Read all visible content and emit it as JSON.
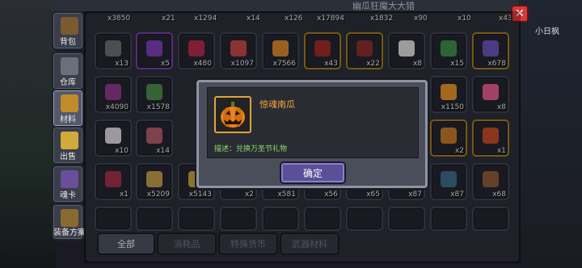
{
  "background": {
    "header_title": "幽瓜狂魔大大猎"
  },
  "sidebar": {
    "items": [
      {
        "label": "背包"
      },
      {
        "label": "仓库"
      },
      {
        "label": "材料"
      },
      {
        "label": "出售"
      },
      {
        "label": "魂卡"
      },
      {
        "label": "装备方案"
      }
    ],
    "active_index": 2
  },
  "close_label": "✕",
  "right_label": "小日枫",
  "top_row_counts": [
    "x3850",
    "x21",
    "x1294",
    "x14",
    "x126",
    "x17894",
    "x1832",
    "x90",
    "x10",
    "x43"
  ],
  "grid": {
    "row1": [
      "x13",
      "x5",
      "x480",
      "x1097",
      "x7566",
      "x43",
      "x22",
      "x8",
      "x15",
      "x678"
    ],
    "row2": [
      "x4090",
      "x1578",
      "",
      "",
      "",
      "",
      "",
      "",
      "x1150",
      "x8"
    ],
    "row3": [
      "x10",
      "x14",
      "",
      "",
      "",
      "",
      "",
      "",
      "x2",
      "x1"
    ],
    "row4": [
      "x1",
      "x5209",
      "x5143",
      "x2",
      "x581",
      "x56",
      "x65",
      "x87",
      "x87",
      "x68"
    ]
  },
  "tabs": [
    {
      "label": "全部"
    },
    {
      "label": "消耗品"
    },
    {
      "label": "特殊货币"
    },
    {
      "label": "武器材料"
    }
  ],
  "dialog": {
    "item_name": "惊魂南瓜",
    "description": "描述：兑换万圣节礼物",
    "confirm_label": "确定",
    "item_icon": "jack-o-lantern-icon"
  },
  "colors": {
    "item_name": "#ffa53a",
    "description": "#8ddc6a",
    "confirm": "#5b4f99",
    "close": "#d8383a"
  }
}
